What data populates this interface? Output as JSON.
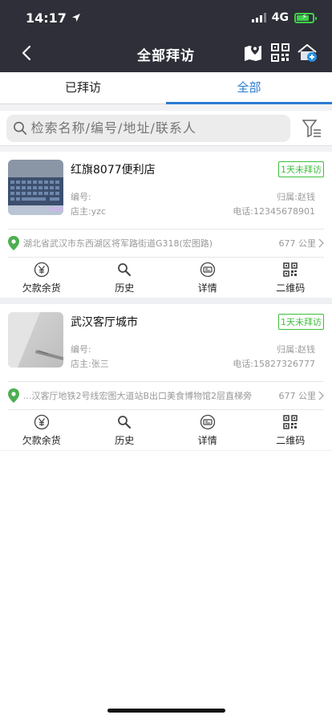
{
  "status_bar": {
    "time": "14:17",
    "network": "4G"
  },
  "nav": {
    "title": "全部拜访"
  },
  "tabs": [
    {
      "label": "已拜访",
      "active": false
    },
    {
      "label": "全部",
      "active": true
    }
  ],
  "search": {
    "placeholder": "检索名称/编号/地址/联系人"
  },
  "stores": [
    {
      "name": "红旗8077便利店",
      "badge": "1天未拜访",
      "code_label": "编号:",
      "owner_label": "店主:yzc",
      "belongs_label": "归属:赵钱",
      "phone_label": "电话:12345678901",
      "address": "湖北省武汉市东西湖区将军路街道G318(宏图路)",
      "distance": "677 公里"
    },
    {
      "name": "武汉客厅城市",
      "badge": "1天未拜访",
      "code_label": "编号:",
      "owner_label": "店主:张三",
      "belongs_label": "归属:赵钱",
      "phone_label": "电话:15827326777",
      "address": "...汉客厅地铁2号线宏图大道站B出口美食博物馆2层直梯旁",
      "distance": "677 公里"
    }
  ],
  "actions": [
    {
      "label": "欠款余货",
      "icon": "yen-circle-icon"
    },
    {
      "label": "历史",
      "icon": "magnifier-icon"
    },
    {
      "label": "详情",
      "icon": "id-card-icon"
    },
    {
      "label": "二维码",
      "icon": "qr-code-icon"
    }
  ],
  "colors": {
    "header_bg": "#2e2f38",
    "accent_blue": "#2a7bd2",
    "badge_green": "#3cbf3c",
    "pin_green": "#4caf50"
  }
}
